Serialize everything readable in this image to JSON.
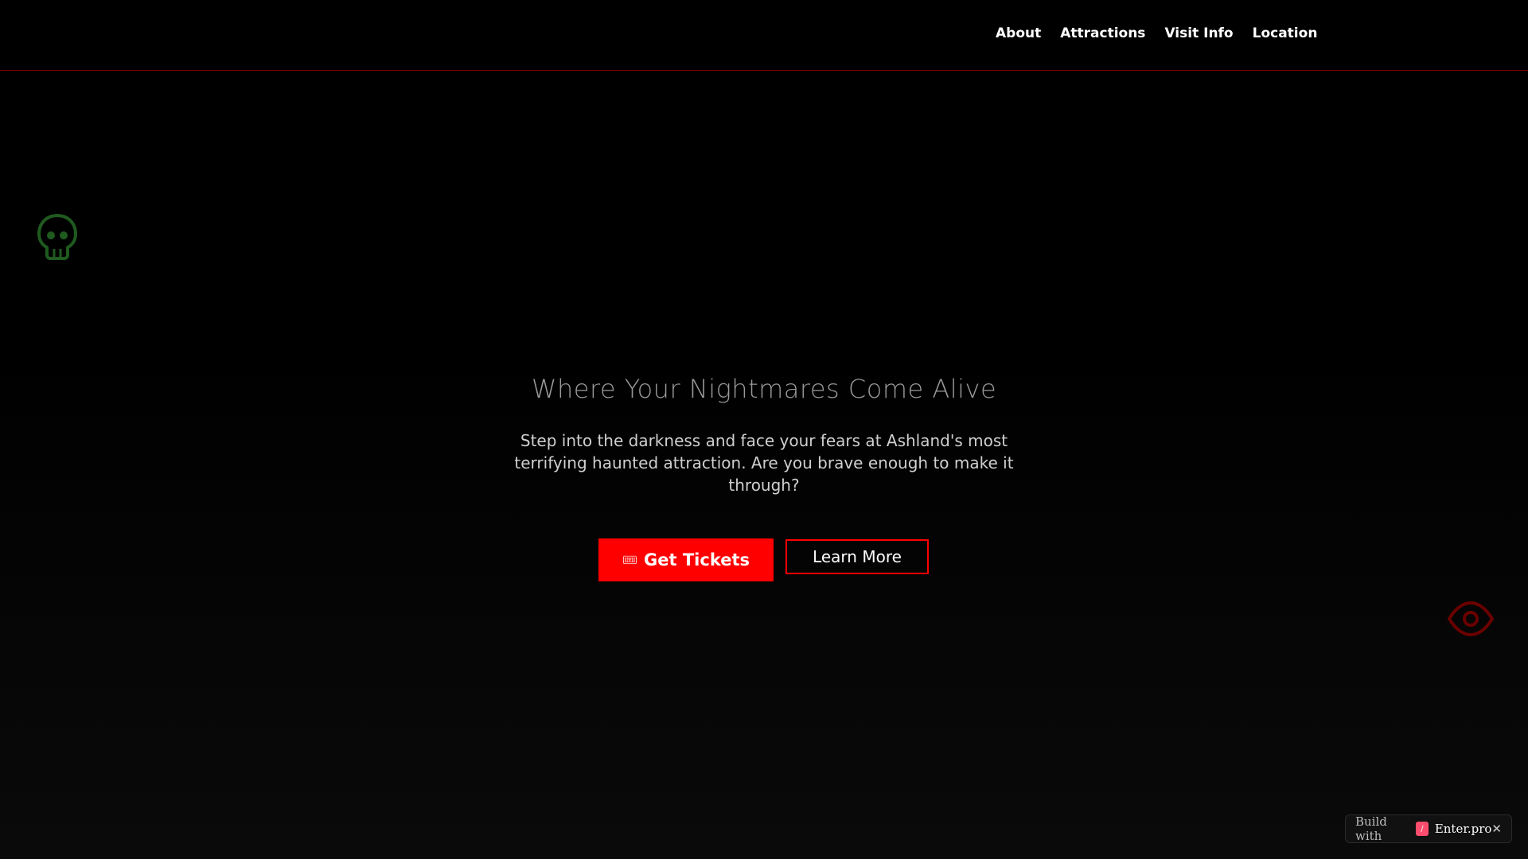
{
  "nav": {
    "items": [
      {
        "label": "About"
      },
      {
        "label": "Attractions"
      },
      {
        "label": "Visit Info"
      },
      {
        "label": "Location"
      }
    ]
  },
  "hero": {
    "title": "Where Your Nightmares Come Alive",
    "description": "Step into the darkness and face your fears at Ashland's most terrifying haunted attraction. Are you brave enough to make it through?",
    "primary_button": {
      "label": "Get Tickets",
      "icon": "ticket-icon"
    },
    "secondary_button": {
      "label": "Learn More"
    }
  },
  "decorations": {
    "skull_icon_color": "#1f5a1f",
    "eye_icon_color": "#6b0000"
  },
  "badge": {
    "prefix": "Build with",
    "name": "Enter.pro",
    "logo_icon": "enter-logo-icon",
    "close_icon": "close-icon"
  },
  "colors": {
    "accent": "#ff0000",
    "background": "#000000",
    "nav_border": "#7a0000"
  }
}
